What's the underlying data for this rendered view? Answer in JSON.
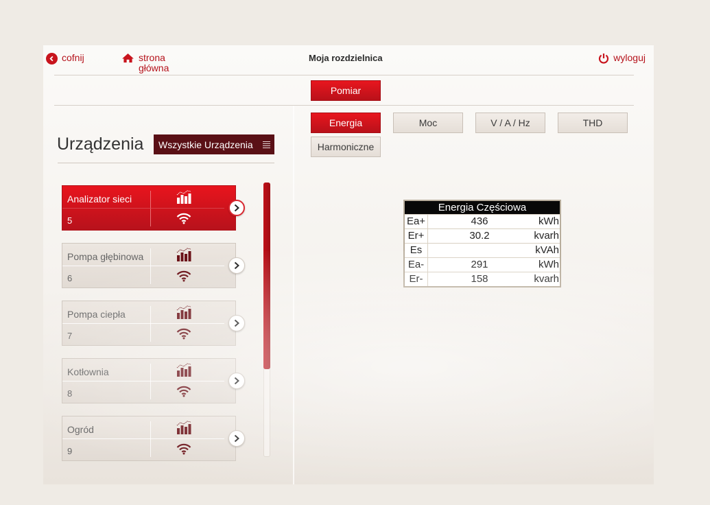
{
  "header": {
    "back_label": "cofnij",
    "home_label_line1": "strona",
    "home_label_line2": "główna",
    "title": "Moja rozdzielnica",
    "logout_label": "wyloguj"
  },
  "main_tab": {
    "label": "Pomiar"
  },
  "sub_tabs": {
    "energia": "Energia",
    "moc": "Moc",
    "vahz": "V / A / Hz",
    "thd": "THD",
    "harmoniczne": "Harmoniczne",
    "active": "Energia"
  },
  "devices": {
    "title": "Urządzenia",
    "filter_label": "Wszystkie Urządzenia",
    "items": [
      {
        "name": "Analizator sieci",
        "number": "5",
        "active": true
      },
      {
        "name": "Pompa głębinowa",
        "number": "6",
        "active": false
      },
      {
        "name": "Pompa ciepła",
        "number": "7",
        "active": false
      },
      {
        "name": "Kotłownia",
        "number": "8",
        "active": false
      },
      {
        "name": "Ogród",
        "number": "9",
        "active": false
      }
    ]
  },
  "energy_table": {
    "title": "Energia Częściowa",
    "rows": [
      {
        "label": "Ea+",
        "value": "436",
        "unit": "kWh"
      },
      {
        "label": "Er+",
        "value": "30.2",
        "unit": "kvarh"
      },
      {
        "label": "Es",
        "value": "",
        "unit": "kVAh"
      },
      {
        "label": "Ea-",
        "value": "291",
        "unit": "kWh"
      },
      {
        "label": "Er-",
        "value": "158",
        "unit": "kvarh"
      }
    ]
  },
  "colors": {
    "accent_red": "#d9141d",
    "dark_maroon": "#5a1016",
    "background": "#efebe5"
  }
}
